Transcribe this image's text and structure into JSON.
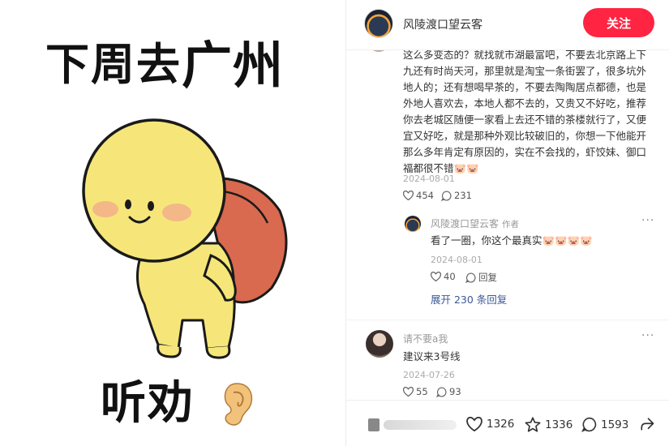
{
  "sticker": {
    "caption_top_a": "下周去",
    "caption_top_b": "广州",
    "caption_bottom": "听劝",
    "colors": {
      "body": "#f6e67a",
      "outline": "#1a1a1a",
      "backpack": "#d9694f",
      "blush": "#f2a38f",
      "ear": "#f2c27a"
    },
    "icons": [
      "smiley-figure",
      "ear-icon"
    ]
  },
  "post": {
    "author_name": "风陵渡口望云客",
    "follow_label": "关注",
    "accent": "#ff2442"
  },
  "comments": [
    {
      "text": "这么多变态的？就找就市湖最富吧，不要去北京路上下九还有时尚天河，那里就是淘宝一条街罢了，很多坑外地人的；还有想喝早茶的，不要去陶陶居点都德，也是外地人喜欢去，本地人都不去的，又贵又不好吃，推荐你去老城区随便一家看上去还不错的茶楼就行了，又便宜又好吃，就是那种外观比较破旧的，你想一下他能开那么多年肯定有原因的，实在不会找的，虾饺妹、御口福都很不错🐷🐷",
      "date": "2024-08-01",
      "likes": "454",
      "replies": "231",
      "reply": {
        "name": "风陵渡口望云客",
        "tag": "作者",
        "text": "看了一圈，你这个最真实🐷🐷🐷🐷",
        "date": "2024-08-01",
        "likes": "40",
        "reply_label": "回复"
      },
      "expand_label": "展开 230 条回复"
    },
    {
      "name": "请不要a我",
      "text": "建议来3号线",
      "date": "2024-07-26",
      "likes": "55",
      "replies": "93"
    }
  ],
  "footer": {
    "likes": "1326",
    "stars": "1336",
    "comments": "1593",
    "icons": [
      "heart-icon",
      "star-icon",
      "comment-icon",
      "share-icon"
    ]
  }
}
